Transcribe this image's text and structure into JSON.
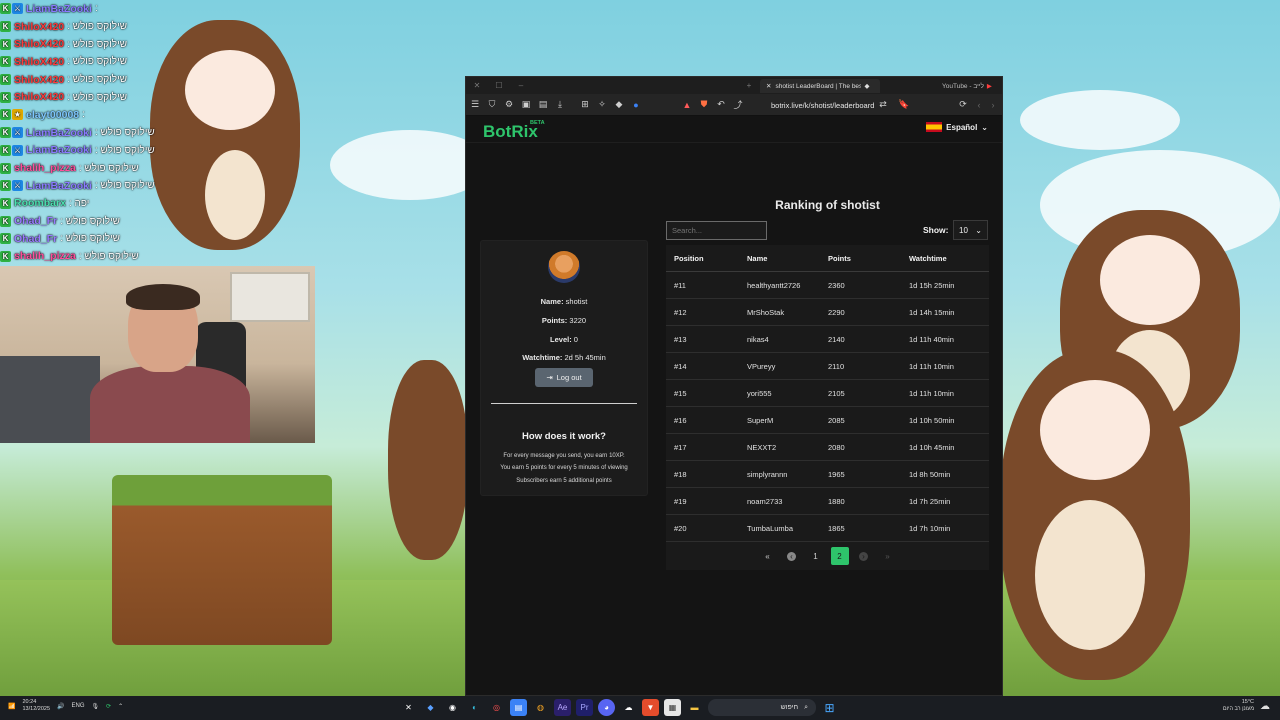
{
  "chat": [
    {
      "user": "LiamBaZooki",
      "color": "#8a7bff",
      "badges": [
        "k",
        "mod"
      ],
      "msg": ":"
    },
    {
      "user": "ShiloX420",
      "color": "#ff3b3b",
      "badges": [
        "k"
      ],
      "msg": ": שילוקס פולש"
    },
    {
      "user": "ShiloX420",
      "color": "#ff3b3b",
      "badges": [
        "k"
      ],
      "msg": ": שילוקס פולש"
    },
    {
      "user": "ShiloX420",
      "color": "#ff3b3b",
      "badges": [
        "k"
      ],
      "msg": ": שילוקס פולש"
    },
    {
      "user": "ShiloX420",
      "color": "#ff3b3b",
      "badges": [
        "k"
      ],
      "msg": ": שילוקס פולש"
    },
    {
      "user": "ShiloX420",
      "color": "#ff3b3b",
      "badges": [
        "k"
      ],
      "msg": ": שילוקס פולש"
    },
    {
      "user": "elayt00008",
      "color": "#7ec8ff",
      "badges": [
        "k",
        "sub"
      ],
      "msg": ":"
    },
    {
      "user": "LiamBaZooki",
      "color": "#8a7bff",
      "badges": [
        "k",
        "mod"
      ],
      "msg": ": שילוקס פולש"
    },
    {
      "user": "LiamBaZooki",
      "color": "#8a7bff",
      "badges": [
        "k",
        "mod"
      ],
      "msg": ": שילוקס פולש"
    },
    {
      "user": "shalih_pizza",
      "color": "#ff4d9a",
      "badges": [
        "k"
      ],
      "msg": ": שילוקס פולש"
    },
    {
      "user": "LiamBaZooki",
      "color": "#8a7bff",
      "badges": [
        "k",
        "mod"
      ],
      "msg": ": שילוקס פולש"
    },
    {
      "user": "Roombarx",
      "color": "#4be0b0",
      "badges": [
        "k"
      ],
      "msg": ": יפה"
    },
    {
      "user": "Ohad_Fr",
      "color": "#9a7bff",
      "badges": [
        "k"
      ],
      "msg": ": שילוקס פולש"
    },
    {
      "user": "Ohad_Fr",
      "color": "#9a7bff",
      "badges": [
        "k"
      ],
      "msg": ": שילוקס פולש"
    },
    {
      "user": "shalih_pizza",
      "color": "#ff4d9a",
      "badges": [
        "k"
      ],
      "msg": ": שילוקס פולש"
    }
  ],
  "browser": {
    "tab_active": "shotist LeaderBoard | The best",
    "tab_youtube": "YouTube - לייב",
    "url": "botrix.live/k/shotist/leaderboard"
  },
  "site": {
    "brand": "BotRix",
    "beta": "BETA",
    "language": "Español",
    "title": "Ranking of shotist"
  },
  "profile": {
    "name_label": "Name:",
    "name": "shotist",
    "points_label": "Points:",
    "points": "3220",
    "level_label": "Level:",
    "level": "0",
    "watchtime_label": "Watchtime:",
    "watchtime": "2d 5h 45min",
    "logout": "Log out",
    "how_title": "How does it work?",
    "how_lines": [
      "For every message you send, you earn 10XP.",
      "You earn 5 points for every 5 minutes of viewing",
      "Subscribers earn 5 additional points"
    ]
  },
  "controls": {
    "search_placeholder": "Search...",
    "show_label": "Show:",
    "show_value": "10"
  },
  "table": {
    "headers": [
      "Position",
      "Name",
      "Points",
      "Watchtime"
    ],
    "rows": [
      [
        "#11",
        "healthyantt2726",
        "2360",
        "1d 15h 25min"
      ],
      [
        "#12",
        "MrShoStak",
        "2290",
        "1d 14h 15min"
      ],
      [
        "#13",
        "nikas4",
        "2140",
        "1d 11h 40min"
      ],
      [
        "#14",
        "VPureyy",
        "2110",
        "1d 11h 10min"
      ],
      [
        "#15",
        "yori555",
        "2105",
        "1d 11h 10min"
      ],
      [
        "#16",
        "SuperM",
        "2085",
        "1d 10h 50min"
      ],
      [
        "#17",
        "NEXXT2",
        "2080",
        "1d 10h 45min"
      ],
      [
        "#18",
        "simplyrannn",
        "1965",
        "1d 8h 50min"
      ],
      [
        "#19",
        "noam2733",
        "1880",
        "1d 7h 25min"
      ],
      [
        "#20",
        "TumbaLumba",
        "1865",
        "1d 7h 10min"
      ]
    ]
  },
  "pagination": {
    "first": "«",
    "prev": "‹",
    "pages": [
      "1",
      "2"
    ],
    "current": "2",
    "next": "›",
    "last": "»"
  },
  "taskbar": {
    "time": "20:24",
    "date": "13/12/2025",
    "lang": "ENG",
    "search": "חיפוש",
    "weather_temp": "15°C",
    "weather_desc": "מעונן רב היום"
  }
}
